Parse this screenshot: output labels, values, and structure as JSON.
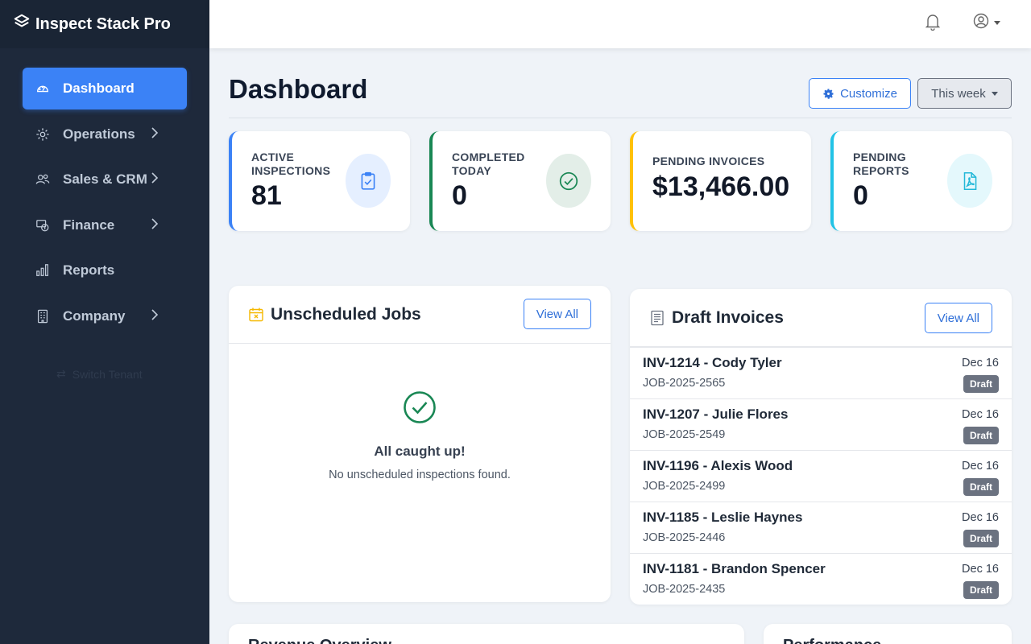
{
  "app": {
    "brand": "Inspect Stack Pro"
  },
  "sidebar": {
    "items": [
      {
        "label": "Dashboard",
        "icon": "speedometer-icon",
        "active": true
      },
      {
        "label": "Operations",
        "icon": "gear-icon",
        "has_children": true
      },
      {
        "label": "Sales & CRM",
        "icon": "people-icon",
        "has_children": true
      },
      {
        "label": "Finance",
        "icon": "money-icon",
        "has_children": true
      },
      {
        "label": "Reports",
        "icon": "bar-chart-icon"
      },
      {
        "label": "Company",
        "icon": "building-icon",
        "has_children": true
      }
    ],
    "switch_tenant": "Switch Tenant"
  },
  "header": {
    "title": "Dashboard",
    "customize_label": "Customize",
    "range_label": "This week"
  },
  "stats": [
    {
      "label": "ACTIVE INSPECTIONS",
      "value": "81",
      "color": "#3b82f6",
      "icon": "clipboard-check-icon"
    },
    {
      "label": "COMPLETED TODAY",
      "value": "0",
      "color": "#198754",
      "icon": "check-circle-icon"
    },
    {
      "label": "PENDING INVOICES",
      "value": "$13,466.00",
      "color": "#ffc107",
      "icon": ""
    },
    {
      "label": "PENDING REPORTS",
      "value": "0",
      "color": "#22c3e6",
      "icon": "pdf-file-icon"
    }
  ],
  "unscheduled": {
    "title": "Unscheduled Jobs",
    "view_all": "View All",
    "empty_title": "All caught up!",
    "empty_sub": "No unscheduled inspections found."
  },
  "draft_invoices": {
    "title": "Draft Invoices",
    "view_all": "View All",
    "rows": [
      {
        "title": "INV-1214 - Cody Tyler",
        "job": "JOB-2025-2565",
        "date": "Dec 16",
        "status": "Draft"
      },
      {
        "title": "INV-1207 - Julie Flores",
        "job": "JOB-2025-2549",
        "date": "Dec 16",
        "status": "Draft"
      },
      {
        "title": "INV-1196 - Alexis Wood",
        "job": "JOB-2025-2499",
        "date": "Dec 16",
        "status": "Draft"
      },
      {
        "title": "INV-1185 - Leslie Haynes",
        "job": "JOB-2025-2446",
        "date": "Dec 16",
        "status": "Draft"
      },
      {
        "title": "INV-1181 - Brandon Spencer",
        "job": "JOB-2025-2435",
        "date": "Dec 16",
        "status": "Draft"
      }
    ]
  },
  "bottom": {
    "revenue_title": "Revenue Overview",
    "performance_title": "Performance"
  }
}
